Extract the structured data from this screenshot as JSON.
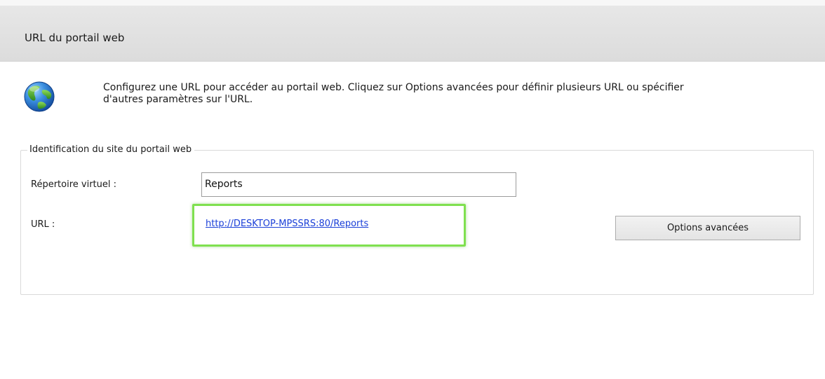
{
  "header": {
    "title": "URL du portail web"
  },
  "intro": {
    "icon": "globe-icon",
    "line1": "Configurez une URL pour accéder au portail web. Cliquez sur Options avancées pour définir plusieurs URL ou spécifier",
    "line2": "d'autres paramètres sur l'URL."
  },
  "site_identification": {
    "legend": "Identification du site du portail web",
    "virtual_directory_label": "Répertoire virtuel :",
    "virtual_directory_value": "Reports",
    "url_label": "URL :",
    "url_value": "http://DESKTOP-MPSSRS:80/Reports",
    "advanced_button_label": "Options avancées"
  },
  "colors": {
    "header_background": "#dcdcdc",
    "link": "#1a3fd8",
    "highlight": "#7fe04f"
  }
}
